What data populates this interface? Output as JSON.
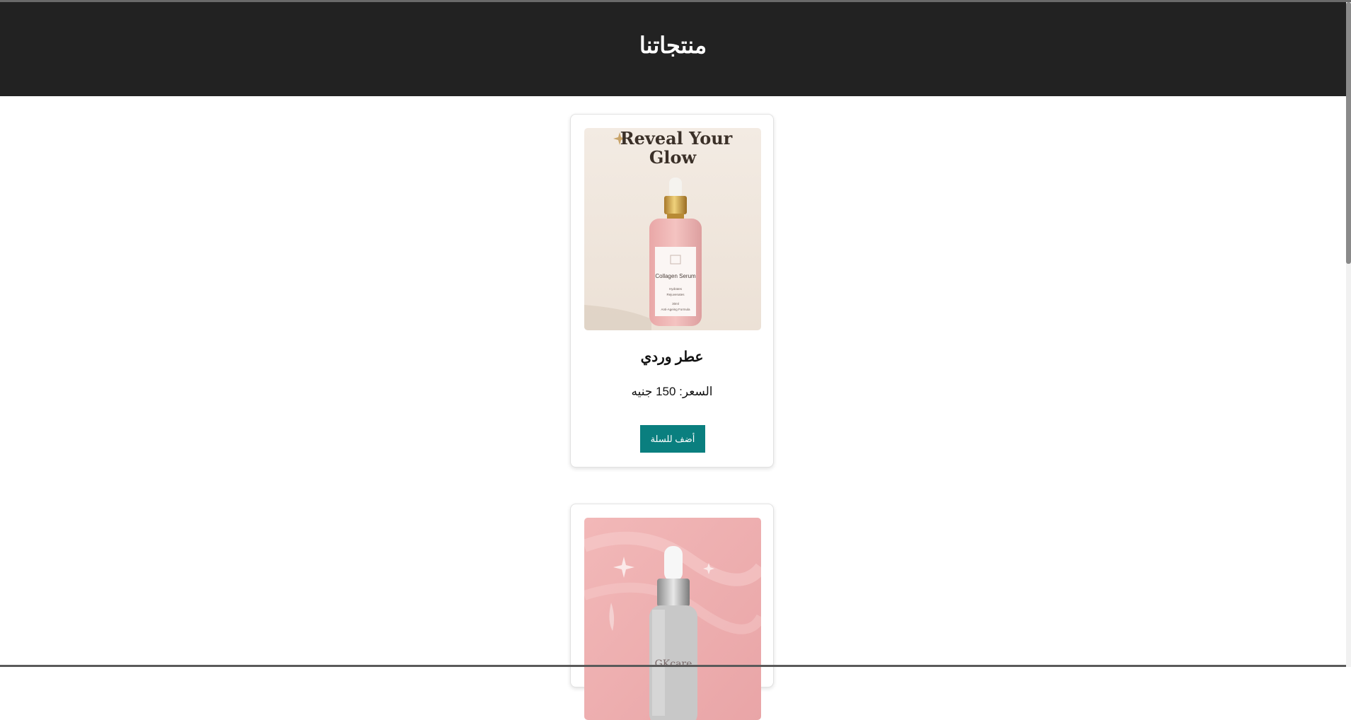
{
  "header": {
    "title": "منتجاتنا"
  },
  "colors": {
    "header_bg": "#222222",
    "button_bg": "#0a7f7f"
  },
  "products": [
    {
      "name": "عطر وردي",
      "price_text": "السعر: 150 جنيه",
      "add_button_label": "أضف للسلة",
      "image": {
        "headline_line1": "Reveal Your",
        "headline_line2": "Glow",
        "bottle_label": "Collagen Serum",
        "bottle_sub1": "Hydrates",
        "bottle_sub2": "Rejuvenates",
        "bottle_sub3": "30ml",
        "bottle_sub4": "Anti-Ageing Formula"
      }
    },
    {
      "image": {
        "brand_label": "GKcare"
      }
    }
  ]
}
